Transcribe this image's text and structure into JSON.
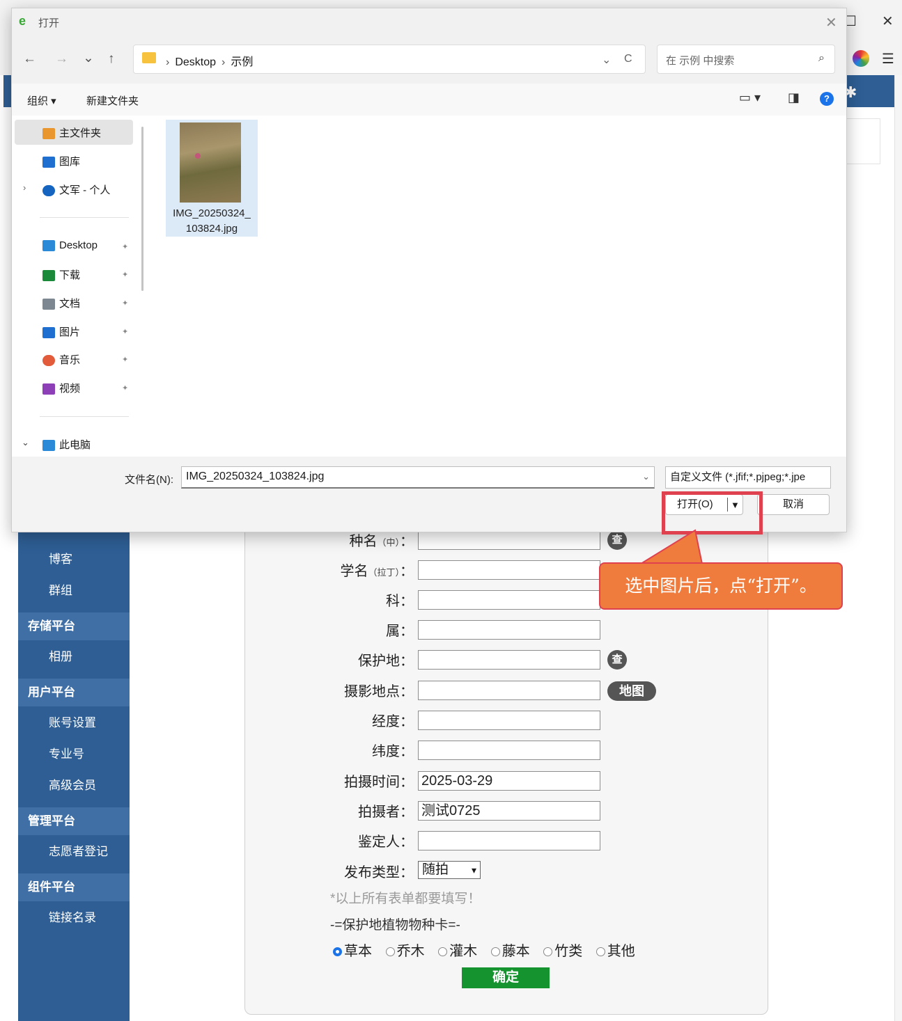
{
  "browser": {
    "window_controls": {
      "maximize": "☐",
      "close": "✕"
    },
    "menu_glyph": "☰",
    "gear_glyph": "✱"
  },
  "sidebar": {
    "items": [
      {
        "label": "博客",
        "kind": "sub"
      },
      {
        "label": "群组",
        "kind": "sub"
      },
      {
        "label": "存储平台",
        "kind": "section"
      },
      {
        "label": "相册",
        "kind": "sub"
      },
      {
        "label": "用户平台",
        "kind": "section"
      },
      {
        "label": "账号设置",
        "kind": "sub"
      },
      {
        "label": "专业号",
        "kind": "sub"
      },
      {
        "label": "高级会员",
        "kind": "sub"
      },
      {
        "label": "管理平台",
        "kind": "section"
      },
      {
        "label": "志愿者登记",
        "kind": "sub"
      },
      {
        "label": "组件平台",
        "kind": "section"
      },
      {
        "label": "链接名录",
        "kind": "sub"
      }
    ]
  },
  "form": {
    "fields": {
      "species_cn": {
        "label": "种名",
        "hint": "（中）",
        "value": ""
      },
      "species_latin": {
        "label": "学名",
        "hint": "（拉丁）",
        "value": ""
      },
      "family": {
        "label": "科",
        "value": ""
      },
      "genus": {
        "label": "属",
        "value": ""
      },
      "reserve": {
        "label": "保护地",
        "value": ""
      },
      "location": {
        "label": "摄影地点",
        "value": ""
      },
      "longitude": {
        "label": "经度",
        "value": ""
      },
      "latitude": {
        "label": "纬度",
        "value": ""
      },
      "shoot_time": {
        "label": "拍摄时间",
        "value": "2025-03-29"
      },
      "photographer": {
        "label": "拍摄者",
        "value": "测试0725"
      },
      "identifier": {
        "label": "鉴定人",
        "value": ""
      },
      "publish_type": {
        "label": "发布类型",
        "value": "随拍"
      }
    },
    "colon": "：",
    "lookup_button": "查",
    "map_button": "地图",
    "required_note": "*以上所有表单都要填写！",
    "card_title": "-=保护地植物物种卡=-",
    "plant_types": [
      {
        "label": "草本",
        "selected": true
      },
      {
        "label": "乔木",
        "selected": false
      },
      {
        "label": "灌木",
        "selected": false
      },
      {
        "label": "藤本",
        "selected": false
      },
      {
        "label": "竹类",
        "selected": false
      },
      {
        "label": "其他",
        "selected": false
      }
    ],
    "submit_button": "确定"
  },
  "dialog": {
    "title": "打开",
    "nav_buttons": {
      "back": "←",
      "forward": "→",
      "recent": "⌄",
      "up": "↑"
    },
    "breadcrumb": [
      "Desktop",
      "示例"
    ],
    "breadcrumb_separator": "›",
    "refresh_glyph": "C",
    "search_placeholder": "在 示例 中搜索",
    "toolbar": {
      "organize": "组织 ▾",
      "new_folder": "新建文件夹"
    },
    "nav_pane": {
      "items": [
        {
          "label": "主文件夹",
          "icon": "home-icon",
          "color": "#e8962d"
        },
        {
          "label": "图库",
          "icon": "gallery-icon",
          "color": "#1f6fd0"
        },
        {
          "label": "文军 - 个人",
          "icon": "cloud-icon",
          "color": "#1565c0"
        },
        {
          "label": "Desktop",
          "icon": "desktop-icon",
          "color": "#2a8ad8"
        },
        {
          "label": "下载",
          "icon": "download-icon",
          "color": "#1a8a3a"
        },
        {
          "label": "文档",
          "icon": "document-icon",
          "color": "#7d8791"
        },
        {
          "label": "图片",
          "icon": "pictures-icon",
          "color": "#1f6fd0"
        },
        {
          "label": "音乐",
          "icon": "music-icon",
          "color": "#e25c3c"
        },
        {
          "label": "视频",
          "icon": "video-icon",
          "color": "#8c3fb6"
        },
        {
          "label": "此电脑",
          "icon": "computer-icon",
          "color": "#2a8ad8"
        }
      ]
    },
    "file": {
      "name_line1": "IMG_20250324_",
      "name_line2": "103824.jpg"
    },
    "filename_label": "文件名(N):",
    "filename_value": "IMG_20250324_103824.jpg",
    "filetype_value": "自定义文件 (*.jfif;*.pjpeg;*.jpe",
    "open_button": "打开(O)",
    "cancel_button": "取消"
  },
  "callout": {
    "text": "选中图片后，点“打开”。",
    "color": "#ef7c3d",
    "highlight_color": "#e0414f"
  }
}
